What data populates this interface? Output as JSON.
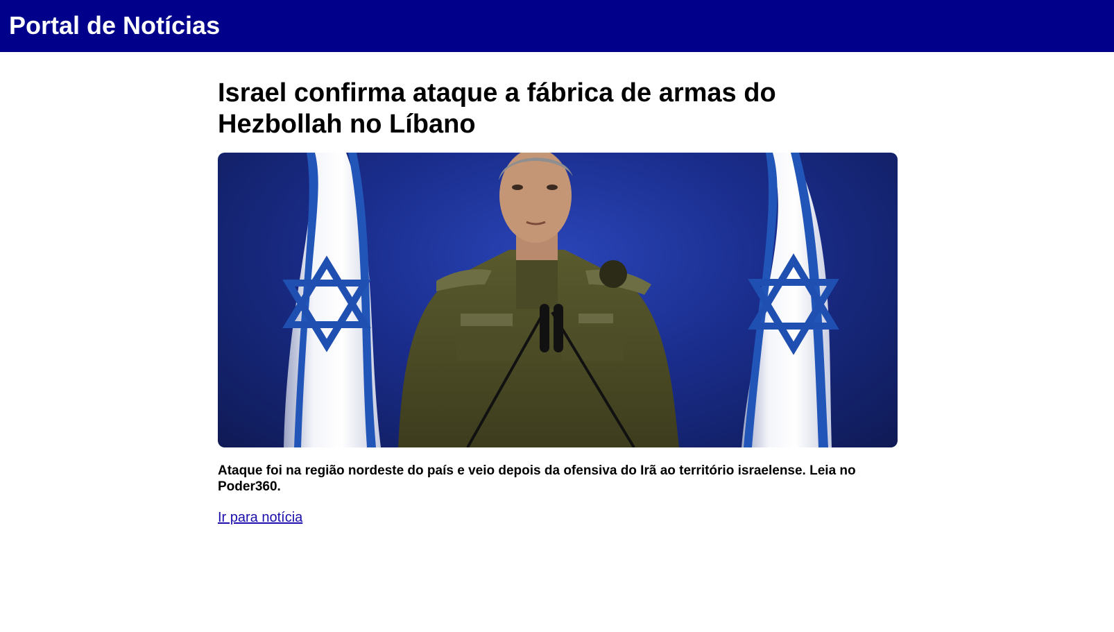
{
  "header": {
    "site_title": "Portal de Notícias",
    "background_color": "#00008b"
  },
  "article": {
    "headline": "Israel confirma ataque a fábrica de armas do Hezbollah no Líbano",
    "image": {
      "description_icon": "article-photo"
    },
    "summary": "Ataque foi na região nordeste do país e veio depois da ofensiva do Irã ao território israelense. Leia no Poder360.",
    "link_label": "Ir para notícia",
    "link_color": "#1a0dab"
  }
}
